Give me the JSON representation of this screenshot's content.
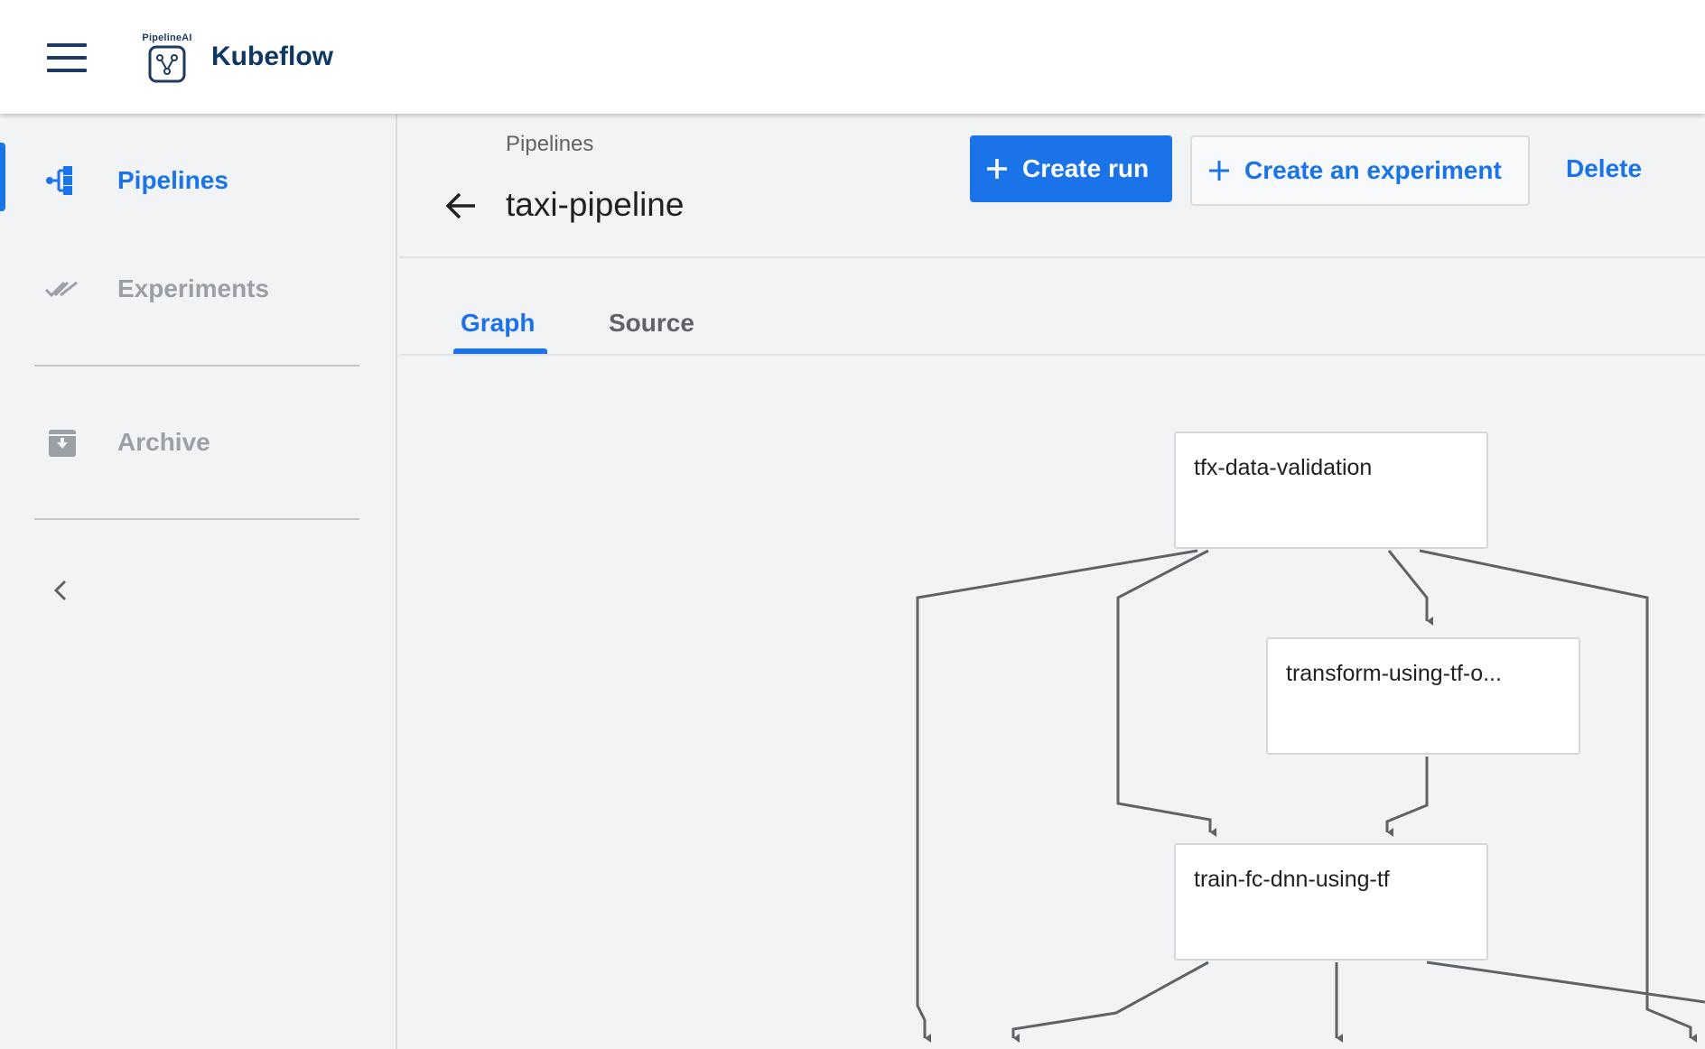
{
  "app": {
    "brand": "Kubeflow",
    "logo_caption": "PipelineAI"
  },
  "colors": {
    "accent": "#1a73e8",
    "brand_text": "#0e3766",
    "edge": "#5f6368"
  },
  "icons": {
    "menu": "hamburger-menu-icon",
    "logo": "pipelineai-logo-icon",
    "pipelines": "pipeline-nodes-icon",
    "experiments": "double-check-icon",
    "archive": "archive-box-icon",
    "collapse": "chevron-left-icon",
    "back": "arrow-back-icon",
    "add": "plus-icon"
  },
  "sidebar": {
    "items": [
      {
        "label": "Pipelines",
        "active": true
      },
      {
        "label": "Experiments",
        "active": false
      },
      {
        "label": "Archive",
        "active": false
      }
    ]
  },
  "header": {
    "breadcrumb": "Pipelines",
    "title": "taxi-pipeline",
    "create_run_label": "Create run",
    "create_experiment_label": "Create an experiment",
    "delete_label": "Delete"
  },
  "tabs": [
    {
      "label": "Graph",
      "active": true
    },
    {
      "label": "Source",
      "active": false
    }
  ],
  "graph": {
    "nodes": [
      {
        "id": "tfx-data-validation",
        "label": "tfx-data-validation"
      },
      {
        "id": "transform-using-tf",
        "label": "transform-using-tf-o..."
      },
      {
        "id": "train-fc-dnn-using-tf",
        "label": "train-fc-dnn-using-tf"
      }
    ]
  }
}
